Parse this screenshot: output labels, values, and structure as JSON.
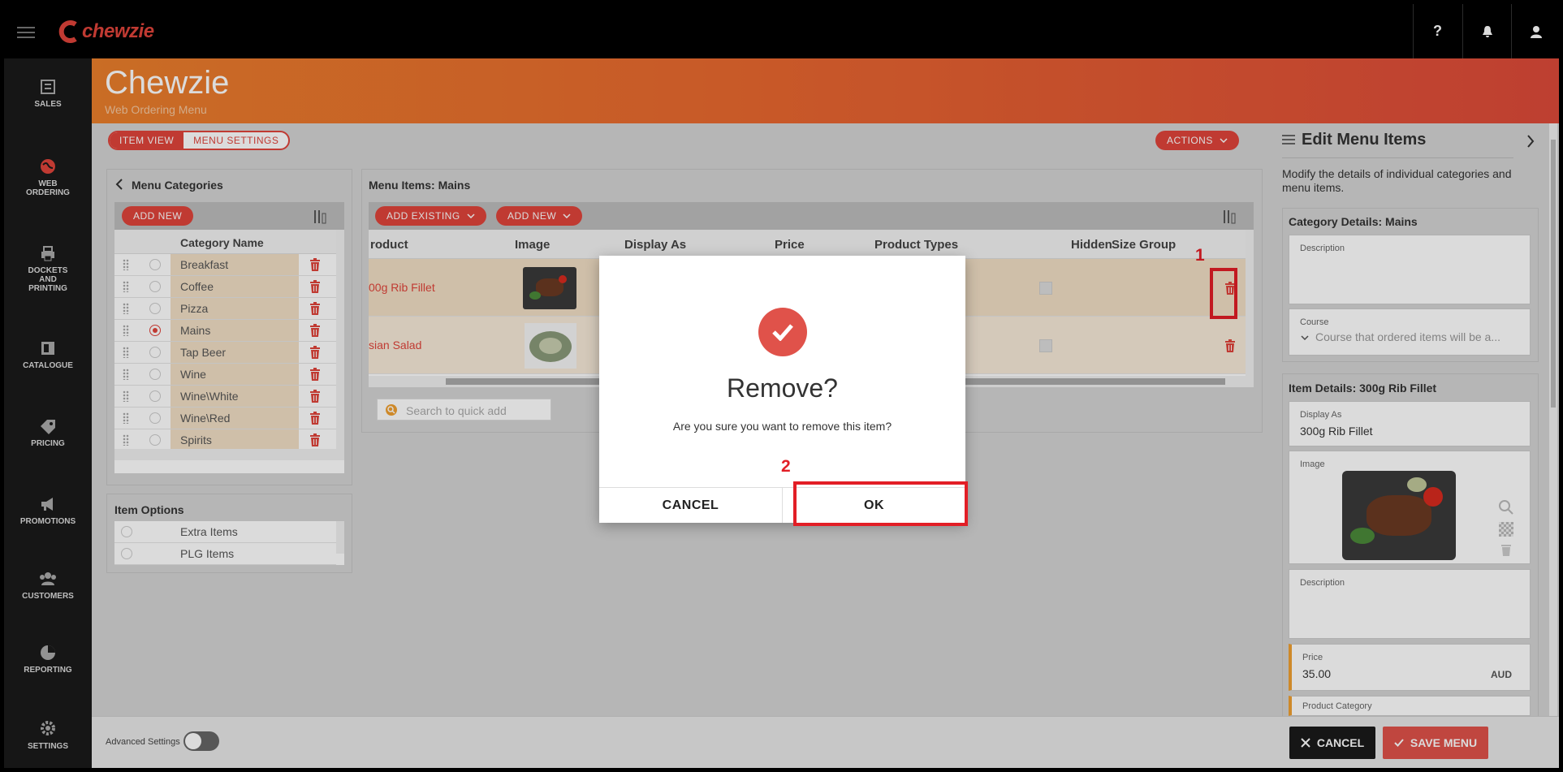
{
  "app": {
    "logo_text": "chewzie",
    "brand_color": "#e0443b",
    "help_label": "?"
  },
  "sidebar": {
    "items": [
      {
        "label": "SALES",
        "icon": "sales-icon"
      },
      {
        "label": "WEB ORDERING",
        "icon": "globe-icon"
      },
      {
        "label": "DOCKETS AND PRINTING",
        "icon": "printer-icon"
      },
      {
        "label": "CATALOGUE",
        "icon": "catalogue-icon"
      },
      {
        "label": "PRICING",
        "icon": "tag-icon"
      },
      {
        "label": "PROMOTIONS",
        "icon": "megaphone-icon"
      },
      {
        "label": "CUSTOMERS",
        "icon": "people-icon"
      },
      {
        "label": "REPORTING",
        "icon": "pie-chart-icon"
      },
      {
        "label": "SETTINGS",
        "icon": "gear-icon"
      }
    ]
  },
  "header": {
    "title": "Chewzie",
    "subtitle": "Web Ordering Menu"
  },
  "view_tabs": {
    "item_view": "ITEM VIEW",
    "menu_settings": "MENU SETTINGS"
  },
  "actions_label": "ACTIONS",
  "categories": {
    "title": "Menu Categories",
    "add_new": "ADD NEW",
    "column_header": "Category Name",
    "items": [
      "Breakfast",
      "Coffee",
      "Pizza",
      "Mains",
      "Tap Beer",
      "Wine",
      "Wine\\White",
      "Wine\\Red",
      "Spirits"
    ],
    "selected": "Mains"
  },
  "item_options": {
    "title": "Item Options",
    "items": [
      "Extra Items",
      "PLG Items"
    ]
  },
  "menu_items": {
    "title": "Menu Items: Mains",
    "add_existing": "ADD EXISTING",
    "add_new": "ADD NEW",
    "columns": [
      "roduct",
      "Image",
      "Display As",
      "Price",
      "Product Types",
      "Hidden",
      "Size Group"
    ],
    "rows": [
      "00g Rib Fillet",
      "sian Salad"
    ],
    "search_placeholder": "Search to quick add"
  },
  "edit_panel": {
    "title": "Edit Menu Items",
    "description": "Modify the details of individual categories and menu items.",
    "category_section": "Category Details: Mains",
    "description_label": "Description",
    "course_label": "Course",
    "course_placeholder": "Course that ordered items will be a...",
    "item_section": "Item Details: 300g Rib Fillet",
    "display_as_label": "Display As",
    "display_as_value": "300g Rib Fillet",
    "image_label": "Image",
    "item_description_label": "Description",
    "price_label": "Price",
    "price_value": "35.00",
    "currency": "AUD",
    "product_category_label": "Product Category"
  },
  "footer": {
    "advanced_settings": "Advanced Settings",
    "cancel": "CANCEL",
    "save_menu": "SAVE MENU"
  },
  "dialog": {
    "title": "Remove?",
    "message": "Are you sure you want to remove this item?",
    "cancel": "CANCEL",
    "ok": "OK"
  },
  "annotations": {
    "step1": "1",
    "step2": "2"
  }
}
